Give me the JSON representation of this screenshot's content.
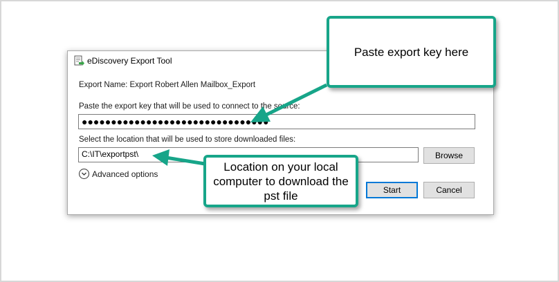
{
  "dialog": {
    "title": "eDiscovery Export Tool",
    "export_name": "Export Name: Export Robert Allen Mailbox_Export",
    "key_label": "Paste the export key that will be used to connect to the source:",
    "key_value": "●●●●●●●●●●●●●●●●●●●●●●●●●●●●●●●●",
    "location_label": "Select the location that will be used to store downloaded files:",
    "location_value": "C:\\IT\\exportpst\\",
    "browse_label": "Browse",
    "advanced_label": "Advanced options",
    "start_label": "Start",
    "cancel_label": "Cancel"
  },
  "callouts": {
    "key_note": "Paste export key here",
    "location_note": "Location on your local computer to download the pst file"
  },
  "colors": {
    "callout_border": "#17a589",
    "arrow": "#17a589",
    "primary_button_border": "#0078d7"
  }
}
